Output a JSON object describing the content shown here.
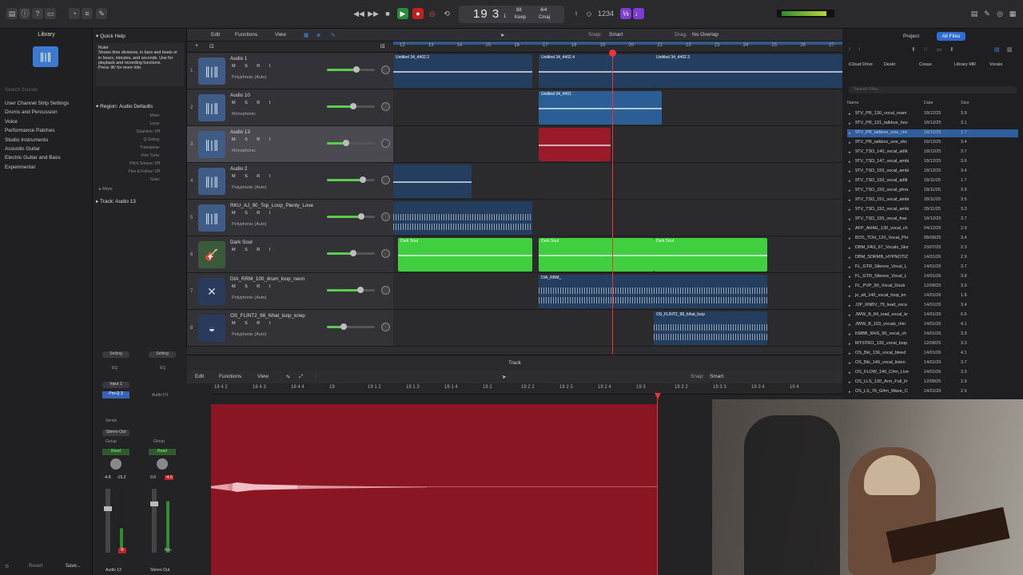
{
  "transport": {
    "position": "19 3",
    "beat": "1",
    "bpm": "88",
    "bpm_label": "Keep",
    "time_signature": "4/4",
    "key": "Cmaj"
  },
  "library": {
    "title": "Library",
    "items": [
      "User Channel Strip Settings",
      "Drums and Percussion",
      "Voice",
      "Performance Patches",
      "Studio Instruments",
      "Acoustic Guitar",
      "Electric Guitar and Bass",
      "Experimental"
    ],
    "search_placeholder": "Search Sounds"
  },
  "quick_help": {
    "title": "Quick Help",
    "heading": "Ruler",
    "body": "Shows time divisions, in bars and beats or in hours, minutes, and seconds. Use for playback and recording functions.",
    "more": "Press ⌘/ for more info."
  },
  "inspector": {
    "region_label": "Region:",
    "region_name": "Audio Defaults",
    "params": [
      "Mute:",
      "Loop:",
      "Quantize: Off",
      "Q-Swing:",
      "Transpose:",
      "Fine Tune:",
      "Pitch Source: Off",
      "Flex & Follow: Off",
      "Gain:"
    ],
    "more": "More",
    "track_label": "Track:",
    "track_name": "Audio 13"
  },
  "main_toolbar": {
    "edit": "Edit",
    "functions": "Functions",
    "view": "View",
    "snap_label": "Snap:",
    "snap_value": "Smart",
    "drag_label": "Drag:",
    "drag_value": "No Overlap"
  },
  "ruler": [
    "12",
    "13",
    "14",
    "15",
    "16",
    "17",
    "18",
    "19",
    "20",
    "21",
    "22",
    "23",
    "24",
    "25",
    "26",
    "27"
  ],
  "tracks": [
    {
      "num": "1",
      "name": "Audio 1",
      "sub": "Polyphonic (Auto)",
      "vol": 0.62
    },
    {
      "num": "2",
      "name": "Audio 10",
      "sub": "Monophonic",
      "vol": 0.55
    },
    {
      "num": "3",
      "name": "Audio 13",
      "sub": "Monophonic",
      "vol": 0.4
    },
    {
      "num": "4",
      "name": "Audio 2",
      "sub": "Polyphonic (Auto)",
      "vol": 0.75
    },
    {
      "num": "5",
      "name": "RKU_AJ_90_Top_Loop_Plenty_Love",
      "sub": "Polyphonic (Auto)",
      "vol": 0.72
    },
    {
      "num": "6",
      "name": "Dark Soul",
      "sub": "",
      "vol": 0.55
    },
    {
      "num": "7",
      "name": "DIA_RRM_100_drum_loop_neon",
      "sub": "Polyphonic (Auto)",
      "vol": 0.7
    },
    {
      "num": "8",
      "name": "OS_FLINT2_98_hihat_loop_kriep",
      "sub": "Polyphonic (Auto)",
      "vol": 0.35
    }
  ],
  "track_controls": "M S R I",
  "regions": {
    "r1": "Untitled 34_4#02.2",
    "r2": "Untitled 34_4#02.4",
    "r3": "Untitled 34_4#02.3",
    "r4": "Untitled 34_4#01",
    "r5": "Dark Soul",
    "r6": "DIA_RRM_",
    "r7": "OS_FLINT2_98_hihat_loop"
  },
  "editor": {
    "title": "Track",
    "edit": "Edit",
    "functions": "Functions",
    "view": "View",
    "snap_label": "Snap:",
    "snap_value": "Smart",
    "ruler": [
      "18 4 2",
      "18 4 3",
      "18 4 4",
      "19",
      "19 1 2",
      "19 1 3",
      "19 1 4",
      "19 2",
      "19 2 2",
      "19 2 3",
      "19 2 4",
      "19 3",
      "19 3 2",
      "19 3 3",
      "19 3 4",
      "19 4"
    ]
  },
  "mixer": {
    "setting": "Setting",
    "eq": "EQ",
    "input": "Input 1",
    "plugin": "Pro-Q 3",
    "audio_fx": "Audio FX",
    "sends": "Sends",
    "bus": "Stereo Out",
    "group": "Group",
    "read": "Read",
    "val1": "-4.8",
    "val2": "-15.2",
    "val3": "0.0",
    "val4": "-4.5",
    "name1": "Audio 13",
    "name2": "Stereo Out",
    "bnc": "Bnc"
  },
  "bottom": {
    "revert": "Revert",
    "save": "Save..."
  },
  "browser": {
    "project": "Project",
    "all_files": "All Files",
    "locations": [
      "iCloud Drive",
      "Deskt",
      "Cosas",
      "Library MR",
      "Vocals"
    ],
    "search_placeholder": "Search Files",
    "col_name": "Name",
    "col_date": "Date",
    "col_size": "Size",
    "files": [
      [
        "9TV_PR_130_vocal_ream",
        "18/12/25",
        "3.9"
      ],
      [
        "9TV_PR_131_talkbox_hoo",
        "18/12/25",
        "3.1"
      ],
      [
        "9TV_PR_talkbox_vow_chc",
        "18/12/25",
        "1.7"
      ],
      [
        "9TV_PR_talkbox_one_shc",
        "18/12/25",
        "3.4"
      ],
      [
        "9TV_TSD_140_vocal_adlit",
        "18/12/25",
        "3.7"
      ],
      [
        "9TV_TSD_147_vocal_ambi",
        "18/12/25",
        "3.6"
      ],
      [
        "9TV_TSD_150_vocal_ambi",
        "18/12/25",
        "3.4"
      ],
      [
        "9TV_TSD_150_vocal_adlit",
        "18/11/25",
        "1.7"
      ],
      [
        "9TV_TSD_150_vocal_phra",
        "18/11/25",
        "3.9"
      ],
      [
        "9TV_TSD_151_vocal_ambi",
        "28/11/25",
        "3.5"
      ],
      [
        "9TV_TSD_152_vocal_ambi",
        "28/11/25",
        "3.3"
      ],
      [
        "9TV_TSD_155_vocal_fras",
        "18/12/25",
        "3.7"
      ],
      [
        "AFP_AHAE_130_vocal_ch",
        "04/12/25",
        "2.9"
      ],
      [
        "BOS_TOH_120_Vocal_Phr",
        "08/08/25",
        "3.4"
      ],
      [
        "DBM_FAS_67_Vocals_Slur",
        "23/07/25",
        "2.3"
      ],
      [
        "DBM_SDRMB_HYPNOTIZ",
        "14/01/26",
        "2.9"
      ],
      [
        "FL_GTR_Silence_Vocal_L",
        "14/01/26",
        "3.7"
      ],
      [
        "FL_GTR_Silence_Vocal_L",
        "14/01/26",
        "3.8"
      ],
      [
        "FL_PVP_90_Vocal_Doub",
        "12/08/25",
        "3.9"
      ],
      [
        "je_alt_140_vocal_loop_kn",
        "14/01/26",
        "1.8"
      ],
      [
        "JJP_RNBV_79_lead_voca",
        "14/01/26",
        "3.4"
      ],
      [
        "JWW_B_84_lead_vocal_kr",
        "14/01/26",
        "6.6"
      ],
      [
        "JWW_B_103_vocals_rhin",
        "14/01/26",
        "4.1"
      ],
      [
        "KMBB_RHS_90_vocal_ch",
        "14/01/26",
        "3.9"
      ],
      [
        "MYSTRO_130_vocal_loop",
        "12/08/25",
        "3.3"
      ],
      [
        "OS_Bki_136_vocal_bleed",
        "14/01/26",
        "4.1"
      ],
      [
        "OS_Bki_149_vocal_listen",
        "14/01/26",
        "3.7"
      ],
      [
        "OS_FLOW_140_C#m_Live",
        "14/01/26",
        "3.3"
      ],
      [
        "OS_LLS_130_Arm_Full_lir",
        "12/08/25",
        "2.9"
      ],
      [
        "OS_LS_76_G#m_Wave_C",
        "14/01/26",
        "2.9"
      ]
    ]
  }
}
